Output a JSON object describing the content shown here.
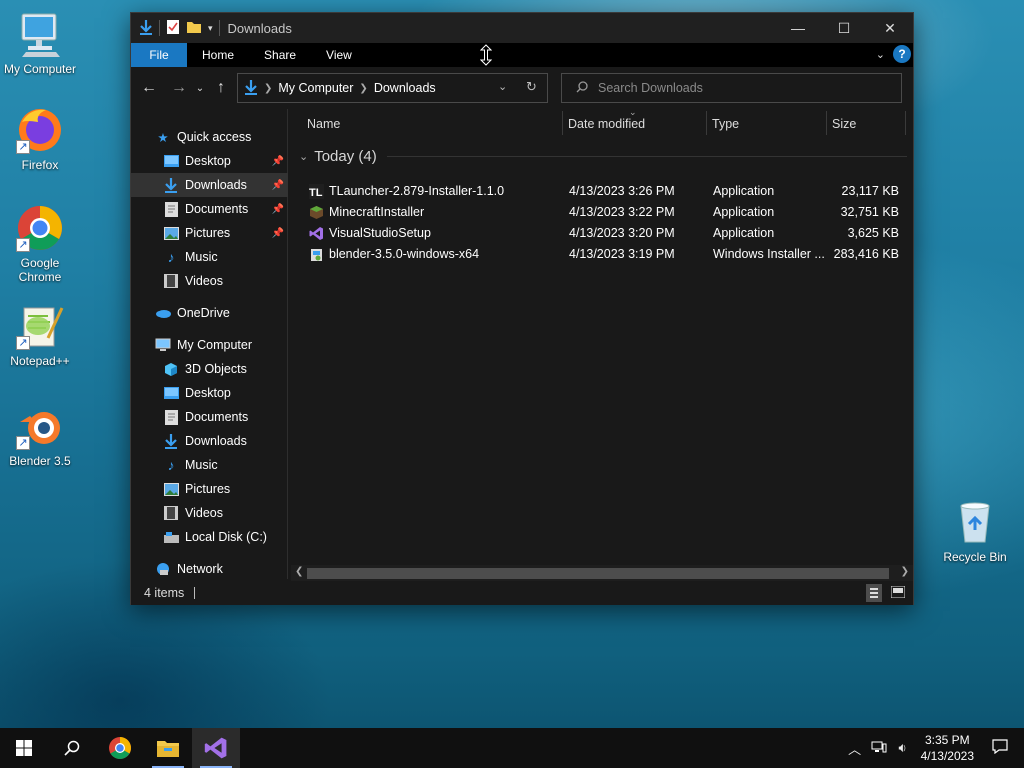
{
  "desktop": {
    "icons": [
      {
        "label": "My Computer"
      },
      {
        "label": "Firefox"
      },
      {
        "label": "Google Chrome"
      },
      {
        "label": "Notepad++"
      },
      {
        "label": "Blender 3.5"
      },
      {
        "label": "Recycle Bin"
      }
    ]
  },
  "window": {
    "title": "Downloads",
    "controls": {
      "minimize": "—",
      "maximize": "☐",
      "close": "✕"
    },
    "ribbon_tabs": [
      "File",
      "Home",
      "Share",
      "View"
    ],
    "help": "?",
    "address": {
      "crumbs": [
        "My Computer",
        "Downloads"
      ]
    },
    "search": {
      "placeholder": "Search Downloads"
    },
    "nav": {
      "quick_access": "Quick access",
      "quick_items": [
        "Desktop",
        "Downloads",
        "Documents",
        "Pictures",
        "Music",
        "Videos"
      ],
      "onedrive": "OneDrive",
      "this_pc": "My Computer",
      "pc_items": [
        "3D Objects",
        "Desktop",
        "Documents",
        "Downloads",
        "Music",
        "Pictures",
        "Videos",
        "Local Disk (C:)"
      ],
      "network": "Network"
    },
    "columns": [
      "Name",
      "Date modified",
      "Type",
      "Size"
    ],
    "group": "Today (4)",
    "files": [
      {
        "name": "TLauncher-2.879-Installer-1.1.0",
        "date": "4/13/2023 3:26 PM",
        "type": "Application",
        "size": "23,117 KB",
        "icon": "tlauncher-icon"
      },
      {
        "name": "MinecraftInstaller",
        "date": "4/13/2023 3:22 PM",
        "type": "Application",
        "size": "32,751 KB",
        "icon": "minecraft-icon"
      },
      {
        "name": "VisualStudioSetup",
        "date": "4/13/2023 3:20 PM",
        "type": "Application",
        "size": "3,625 KB",
        "icon": "visual-studio-icon"
      },
      {
        "name": "blender-3.5.0-windows-x64",
        "date": "4/13/2023 3:19 PM",
        "type": "Windows Installer ...",
        "size": "283,416 KB",
        "icon": "msi-installer-icon"
      }
    ],
    "status": "4 items"
  },
  "taskbar": {
    "clock_time": "3:35 PM",
    "clock_date": "4/13/2023"
  },
  "colors": {
    "accent": "#1a78c2",
    "window_bg": "#191919",
    "selected_bg": "#333333"
  }
}
